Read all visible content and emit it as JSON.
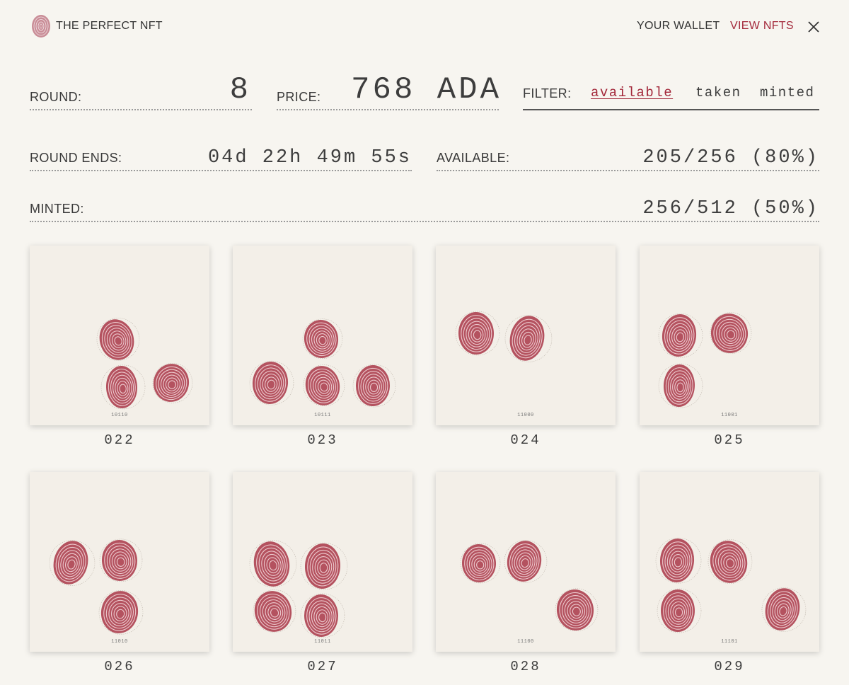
{
  "header": {
    "brand": "THE PERFECT NFT",
    "nav_wallet": "YOUR WALLET",
    "nav_view": "VIEW NFTS",
    "accent_color": "#a3283a"
  },
  "stats": {
    "round_label": "ROUND:",
    "round_value": "8",
    "price_label": "PRICE:",
    "price_value": "768 ADA",
    "filter_label": "FILTER:",
    "filter_options": [
      "available",
      "taken",
      "minted"
    ],
    "filter_selected": "available",
    "round_ends_label": "ROUND ENDS:",
    "round_ends_value": "04d 22h 49m 55s",
    "available_label": "AVAILABLE:",
    "available_value": "205/256 (80%)",
    "minted_label": "MINTED:",
    "minted_value": "256/512 (50%)"
  },
  "nfts": [
    {
      "number": "022",
      "code": "10110"
    },
    {
      "number": "023",
      "code": "10111"
    },
    {
      "number": "024",
      "code": "11000"
    },
    {
      "number": "025",
      "code": "11001"
    },
    {
      "number": "026",
      "code": "11010"
    },
    {
      "number": "027",
      "code": "11011"
    },
    {
      "number": "028",
      "code": "11100"
    },
    {
      "number": "029",
      "code": "11101"
    }
  ],
  "icons": {
    "logo": "fingerprint-logo-icon",
    "close": "close-icon",
    "nft_mark": "fingerprint-icon"
  }
}
